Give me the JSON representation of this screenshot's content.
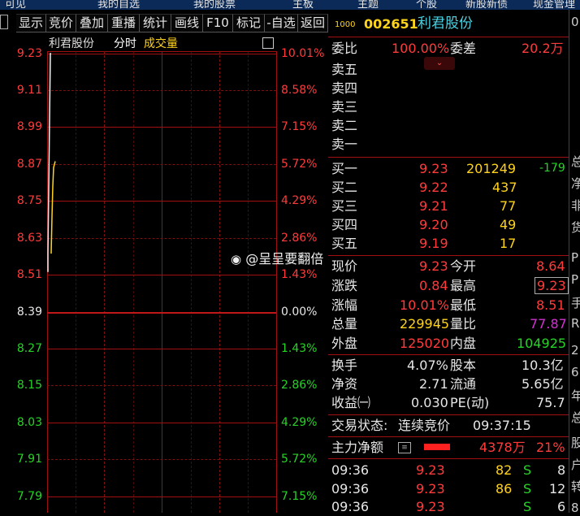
{
  "top_strip": [
    "可见",
    "我的自选",
    "我的股票",
    "主板",
    "主题",
    "个股",
    "新股新债",
    "现金管理"
  ],
  "toolbar": {
    "buttons": [
      "显示",
      "竞价",
      "叠加",
      "重播",
      "统计",
      "画线",
      "F10",
      "标记",
      "-自选",
      "返回"
    ]
  },
  "chart_header": {
    "name": "利君股份",
    "mode": "分时",
    "indicator": "成交量"
  },
  "chart_data": {
    "type": "line",
    "title": "利君股份 分时",
    "prev_close": 8.39,
    "ylim": [
      7.75,
      9.23
    ],
    "price_ticks": [
      "9.23",
      "9.11",
      "8.99",
      "8.87",
      "8.75",
      "8.63",
      "8.51",
      "8.39",
      "8.27",
      "8.15",
      "8.03",
      "7.91",
      "7.79"
    ],
    "pct_ticks": [
      "10.01%",
      "8.58%",
      "7.15%",
      "5.72%",
      "4.29%",
      "2.86%",
      "1.43%",
      "0.00%",
      "1.43%",
      "2.86%",
      "4.29%",
      "5.72%",
      "7.15%"
    ],
    "series": [
      {
        "values": [
          8.52,
          8.58,
          9.23,
          9.23,
          9.23
        ]
      },
      {
        "values": [
          8.58,
          8.7,
          8.8,
          8.86,
          8.88
        ]
      }
    ]
  },
  "watermark": "@呈呈要翻倍",
  "stock": {
    "prefix": "1000",
    "code": "002651",
    "name": "利君股份"
  },
  "weibi": {
    "label": "委比",
    "value": "100.00%",
    "diff_label": "委差",
    "diff_value": "20.2万"
  },
  "sell": [
    {
      "label": "卖五"
    },
    {
      "label": "卖四"
    },
    {
      "label": "卖三"
    },
    {
      "label": "卖二"
    },
    {
      "label": "卖一"
    }
  ],
  "buy": [
    {
      "label": "买一",
      "price": "9.23",
      "vol": "201249",
      "chg": "-179"
    },
    {
      "label": "买二",
      "price": "9.22",
      "vol": "437",
      "chg": ""
    },
    {
      "label": "买三",
      "price": "9.21",
      "vol": "77",
      "chg": ""
    },
    {
      "label": "买四",
      "price": "9.20",
      "vol": "49",
      "chg": ""
    },
    {
      "label": "买五",
      "price": "9.19",
      "vol": "17",
      "chg": ""
    }
  ],
  "quote": [
    {
      "l1": "现价",
      "v1": "9.23",
      "l2": "今开",
      "v2": "8.64"
    },
    {
      "l1": "涨跌",
      "v1": "0.84",
      "l2": "最高",
      "v2": "9.23"
    },
    {
      "l1": "涨幅",
      "v1": "10.01%",
      "l2": "最低",
      "v2": "8.51"
    },
    {
      "l1": "总量",
      "v1": "229945",
      "l2": "量比",
      "v2": "77.87"
    },
    {
      "l1": "外盘",
      "v1": "125020",
      "l2": "内盘",
      "v2": "104925"
    }
  ],
  "fundamentals": [
    {
      "l1": "换手",
      "v1": "4.07%",
      "l2": "股本",
      "v2": "10.3亿"
    },
    {
      "l1": "净资",
      "v1": "2.71",
      "l2": "流通",
      "v2": "5.65亿"
    },
    {
      "l1": "收益㈠",
      "v1": "0.030",
      "l2": "PE(动)",
      "v2": "75.7"
    }
  ],
  "trade_status": {
    "label": "交易状态:",
    "value": "连续竞价",
    "time": "09:37:15"
  },
  "main_flow": {
    "label": "主力净额",
    "amount": "4378万",
    "pct": "21%"
  },
  "ticks": [
    {
      "time": "09:36",
      "price": "9.23",
      "vol": "82",
      "side": "S",
      "count": "8"
    },
    {
      "time": "09:36",
      "price": "9.23",
      "vol": "86",
      "side": "S",
      "count": "12"
    },
    {
      "time": "09:36",
      "price": "9.23",
      "vol": "",
      "side": "S",
      "count": "6"
    }
  ],
  "far_right": [
    "0",
    "总",
    "净",
    "非",
    "货",
    "P",
    "P",
    "手",
    "R",
    "2",
    "6",
    "年",
    "总",
    "股",
    "户",
    "转",
    "8"
  ],
  "colors": {
    "up": "#ff3b3b",
    "down": "#26d326",
    "grid": "#a01010",
    "code": "#ffd31a",
    "name": "#4cd0e0"
  }
}
